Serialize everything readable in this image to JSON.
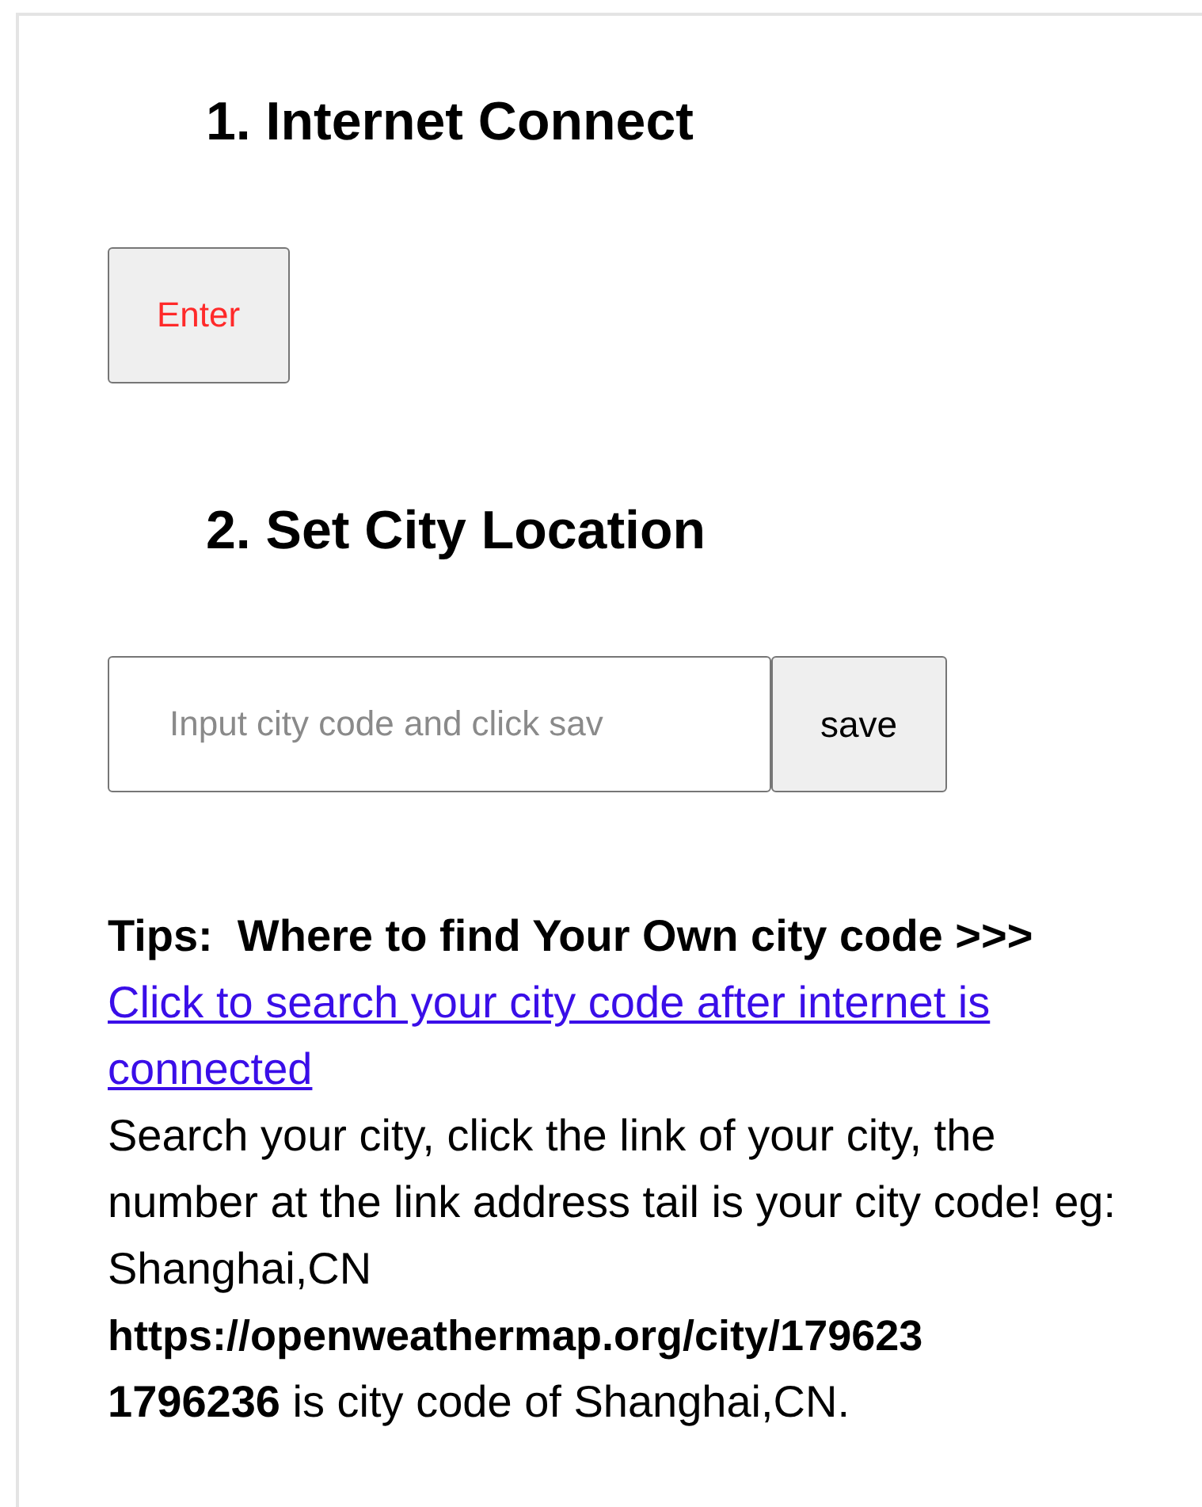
{
  "sections": [
    {
      "heading": "1. Internet Connect",
      "kind": "button",
      "button": "Enter"
    },
    {
      "heading": "2. Set City Location",
      "kind": "input",
      "placeholder": "Input city code and click sav",
      "button": "save"
    }
  ],
  "tips": {
    "title": "Tips:  Where to find Your Own city code >>>",
    "link": "Click to search your city code after internet is connected",
    "description": "Search your city, click the link of your city, the number at the link address tail is your city code! eg: Shanghai,CN",
    "url": "https://openweathermap.org/city/179623",
    "note": "**1796236** is city code of Shanghai,CN."
  }
}
